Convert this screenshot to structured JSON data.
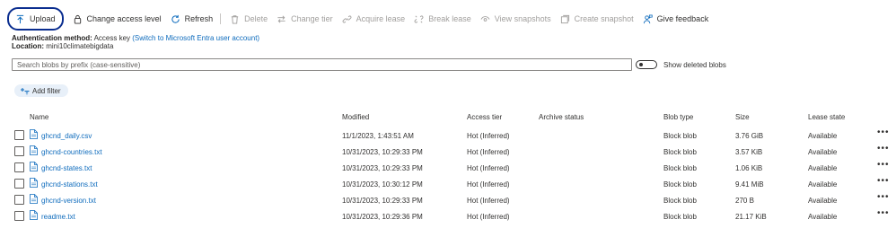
{
  "toolbar": {
    "upload": "Upload",
    "change_access_level": "Change access level",
    "refresh": "Refresh",
    "delete": "Delete",
    "change_tier": "Change tier",
    "acquire_lease": "Acquire lease",
    "break_lease": "Break lease",
    "view_snapshots": "View snapshots",
    "create_snapshot": "Create snapshot",
    "give_feedback": "Give feedback"
  },
  "info": {
    "auth_label": "Authentication method:",
    "auth_value": "Access key",
    "auth_link": "(Switch to Microsoft Entra user account)",
    "location_label": "Location:",
    "location_value": "mini10climatebigdata"
  },
  "search": {
    "placeholder": "Search blobs by prefix (case-sensitive)",
    "value": ""
  },
  "show_deleted": {
    "label": "Show deleted blobs",
    "enabled": false
  },
  "add_filter": "Add filter",
  "columns": {
    "name": "Name",
    "modified": "Modified",
    "access_tier": "Access tier",
    "archive_status": "Archive status",
    "blob_type": "Blob type",
    "size": "Size",
    "lease_state": "Lease state"
  },
  "rows": [
    {
      "name": "ghcnd_daily.csv",
      "modified": "11/1/2023, 1:43:51 AM",
      "access_tier": "Hot (Inferred)",
      "archive_status": "",
      "blob_type": "Block blob",
      "size": "3.76 GiB",
      "lease_state": "Available"
    },
    {
      "name": "ghcnd-countries.txt",
      "modified": "10/31/2023, 10:29:33 PM",
      "access_tier": "Hot (Inferred)",
      "archive_status": "",
      "blob_type": "Block blob",
      "size": "3.57 KiB",
      "lease_state": "Available"
    },
    {
      "name": "ghcnd-states.txt",
      "modified": "10/31/2023, 10:29:33 PM",
      "access_tier": "Hot (Inferred)",
      "archive_status": "",
      "blob_type": "Block blob",
      "size": "1.06 KiB",
      "lease_state": "Available"
    },
    {
      "name": "ghcnd-stations.txt",
      "modified": "10/31/2023, 10:30:12 PM",
      "access_tier": "Hot (Inferred)",
      "archive_status": "",
      "blob_type": "Block blob",
      "size": "9.41 MiB",
      "lease_state": "Available"
    },
    {
      "name": "ghcnd-version.txt",
      "modified": "10/31/2023, 10:29:33 PM",
      "access_tier": "Hot (Inferred)",
      "archive_status": "",
      "blob_type": "Block blob",
      "size": "270 B",
      "lease_state": "Available"
    },
    {
      "name": "readme.txt",
      "modified": "10/31/2023, 10:29:36 PM",
      "access_tier": "Hot (Inferred)",
      "archive_status": "",
      "blob_type": "Block blob",
      "size": "21.17 KiB",
      "lease_state": "Available"
    }
  ],
  "row_menu": "•••",
  "colors": {
    "accent": "#0f6cbd",
    "upload_highlight": "#0a2d8f",
    "disabled": "#a19f9d",
    "filter_bg": "#e8f0f9"
  }
}
